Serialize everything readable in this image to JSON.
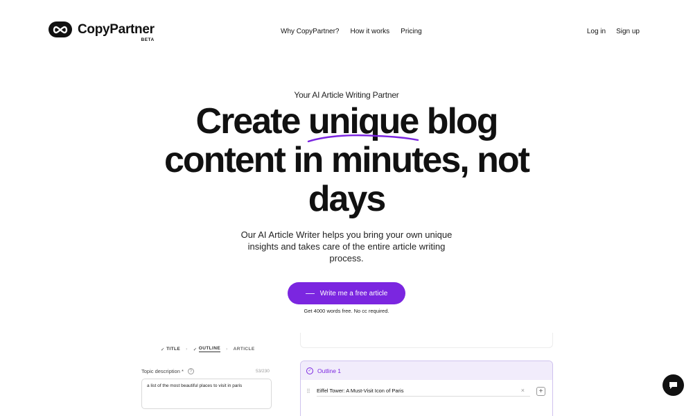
{
  "header": {
    "brand": "CopyPartner",
    "badge": "BETA",
    "nav": [
      "Why CopyPartner?",
      "How it works",
      "Pricing"
    ],
    "login": "Log in",
    "signup": "Sign up"
  },
  "hero": {
    "eyebrow": "Your AI Article Writing Partner",
    "headline_1a": "Create",
    "headline_1b": "unique",
    "headline_1c": "blog",
    "headline_2": "content in minutes, not",
    "headline_3": "days",
    "subtext": "Our AI Article Writer helps you bring your own unique insights and takes care of the entire article writing process.",
    "cta_label": "Write me a free article",
    "cta_note": "Get 4000 words free. No cc required."
  },
  "demo": {
    "steps": [
      "TITLE",
      "OUTLINE",
      "ARTICLE"
    ],
    "topic_label": "Topic description *",
    "topic_count": "53/230",
    "topic_value": "a list of the most beautiful places to visit in paris",
    "outline_title": "Outline 1",
    "outline_item": "Eiffel Tower: A Must-Visit Icon of Paris"
  },
  "colors": {
    "accent": "#7b26e0",
    "accent_soft": "#f1ecfb"
  }
}
